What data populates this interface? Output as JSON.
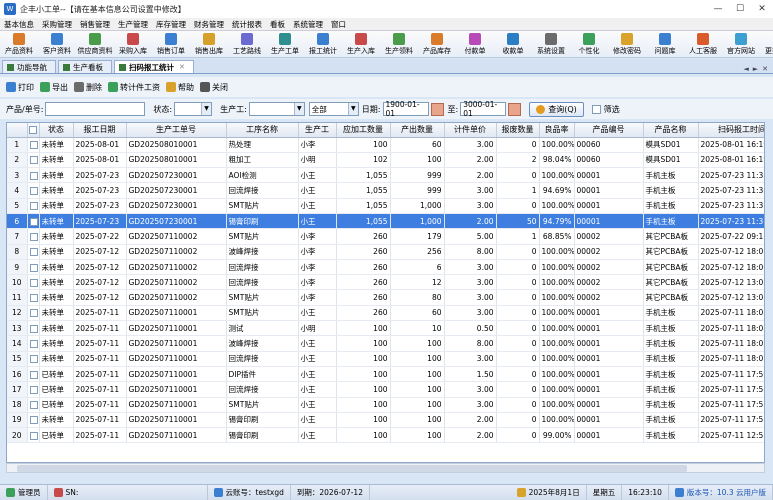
{
  "window": {
    "title": "企丰小工单--【请在基本信息公司设置中修改】",
    "controls": [
      "—",
      "☐",
      "✕"
    ]
  },
  "menu": [
    "基本信息",
    "采购管理",
    "销售管理",
    "生产管理",
    "库存管理",
    "财务管理",
    "统计报表",
    "看板",
    "系统管理",
    "窗口"
  ],
  "toolbar": [
    {
      "label": "产品资料",
      "color": "#d97b2a"
    },
    {
      "label": "客户资料",
      "color": "#3b7fd1"
    },
    {
      "label": "供应商资料",
      "color": "#4a9b4a"
    },
    {
      "label": "采购入库",
      "color": "#c94a4a"
    },
    {
      "label": "销售订单",
      "color": "#3b7fd1"
    },
    {
      "label": "销售出库",
      "color": "#d6a02a"
    },
    {
      "label": "工艺路线",
      "color": "#6a6ad1"
    },
    {
      "label": "生产工单",
      "color": "#2f8f8f"
    },
    {
      "label": "报工统计",
      "color": "#3b7fd1"
    },
    {
      "label": "生产入库",
      "color": "#c94a4a"
    },
    {
      "label": "生产领料",
      "color": "#4a9b4a"
    },
    {
      "label": "产品库存",
      "color": "#d97b2a"
    },
    {
      "label": "付款单",
      "color": "#b84ab8"
    },
    {
      "label": "收款单",
      "color": "#2a7fc4"
    },
    {
      "label": "系统设置",
      "color": "#6b6b6b"
    },
    {
      "label": "个性化",
      "color": "#3aa05a"
    },
    {
      "label": "修改密码",
      "color": "#d9a22a"
    },
    {
      "label": "问题库",
      "color": "#3b7fd1"
    },
    {
      "label": "人工客服",
      "color": "#d95a2a"
    },
    {
      "label": "官方网站",
      "color": "#3b9fd1"
    },
    {
      "label": "更换皮肤",
      "color": "#c44a8a"
    }
  ],
  "tabs": [
    {
      "label": "功能导航",
      "active": false
    },
    {
      "label": "生产看板",
      "active": false
    },
    {
      "label": "扫码报工统计",
      "active": true
    }
  ],
  "tab_nav": [
    "◄",
    "►",
    "✕"
  ],
  "actions": [
    {
      "label": "打印",
      "color": "#3b7fd1"
    },
    {
      "label": "导出",
      "color": "#3aa05a"
    },
    {
      "label": "删除",
      "color": "#6b6b6b"
    },
    {
      "label": "转计件工资",
      "color": "#3aa05a"
    },
    {
      "label": "帮助",
      "color": "#d9a22a"
    },
    {
      "label": "关闭",
      "color": "#555555"
    }
  ],
  "filters": {
    "product_label": "产品/单号:",
    "status_label": "状态:",
    "worker_label": "生产工:",
    "range_value": "全部",
    "date_label": "日期:",
    "date_from": "1900-01-01",
    "to_label": "至:",
    "date_to": "3000-01-01",
    "query_label": "查询(Q)",
    "filter_label": "筛选"
  },
  "table": {
    "headers": [
      "",
      "",
      "状态",
      "报工日期",
      "生产工单号",
      "工序名称",
      "生产工",
      "应加工数量",
      "产出数量",
      "计件单价",
      "报废数量",
      "良品率",
      "产品编号",
      "产品名称",
      "扫码报工时间"
    ],
    "selected_row": 6,
    "rows": [
      [
        "1",
        "未转单",
        "2025-08-01",
        "GD202508010001",
        "热处理",
        "小李",
        "100",
        "60",
        "3.00",
        "0",
        "100.00%",
        "00060",
        "模具SD01",
        "2025-08-01 16:19:05"
      ],
      [
        "2",
        "未转单",
        "2025-08-01",
        "GD202508010001",
        "粗加工",
        "小明",
        "102",
        "100",
        "2.00",
        "2",
        "98.04%",
        "00060",
        "模具SD01",
        "2025-08-01 16:19:03"
      ],
      [
        "3",
        "未转单",
        "2025-07-23",
        "GD202507230001",
        "AOI检测",
        "小王",
        "1,055",
        "999",
        "2.00",
        "0",
        "100.00%",
        "00001",
        "手机主板",
        "2025-07-23 11:35:36"
      ],
      [
        "4",
        "未转单",
        "2025-07-23",
        "GD202507230001",
        "回流焊接",
        "小王",
        "1,055",
        "999",
        "3.00",
        "1",
        "94.69%",
        "00001",
        "手机主板",
        "2025-07-23 11:35:26"
      ],
      [
        "5",
        "未转单",
        "2025-07-23",
        "GD202507230001",
        "SMT贴片",
        "小王",
        "1,055",
        "1,000",
        "3.00",
        "0",
        "100.00%",
        "00001",
        "手机主板",
        "2025-07-23 11:35:13"
      ],
      [
        "6",
        "未转单",
        "2025-07-23",
        "GD202507230001",
        "锡膏印刷",
        "小王",
        "1,055",
        "1,000",
        "2.00",
        "50",
        "94.79%",
        "00001",
        "手机主板",
        "2025-07-23 11:31:48"
      ],
      [
        "7",
        "未转单",
        "2025-07-22",
        "GD202507110002",
        "SMT贴片",
        "小李",
        "260",
        "179",
        "5.00",
        "1",
        "68.85%",
        "00002",
        "其它PCBA板",
        "2025-07-22 09:15:26"
      ],
      [
        "8",
        "未转单",
        "2025-07-12",
        "GD202507110002",
        "波峰焊接",
        "小李",
        "260",
        "256",
        "8.00",
        "0",
        "100.00%",
        "00002",
        "其它PCBA板",
        "2025-07-12 18:07:08"
      ],
      [
        "9",
        "未转单",
        "2025-07-12",
        "GD202507110002",
        "回流焊接",
        "小李",
        "260",
        "6",
        "3.00",
        "0",
        "100.00%",
        "00002",
        "其它PCBA板",
        "2025-07-12 18:06:05"
      ],
      [
        "10",
        "未转单",
        "2025-07-12",
        "GD202507110002",
        "回流焊接",
        "小李",
        "260",
        "12",
        "3.00",
        "0",
        "100.00%",
        "00002",
        "其它PCBA板",
        "2025-07-12 13:03:57"
      ],
      [
        "11",
        "未转单",
        "2025-07-12",
        "GD202507110002",
        "SMT贴片",
        "小李",
        "260",
        "80",
        "3.00",
        "0",
        "100.00%",
        "00002",
        "其它PCBA板",
        "2025-07-12 13:03:33"
      ],
      [
        "12",
        "未转单",
        "2025-07-11",
        "GD202507110001",
        "SMT贴片",
        "小王",
        "260",
        "60",
        "3.00",
        "0",
        "100.00%",
        "00001",
        "手机主板",
        "2025-07-11 18:05:44"
      ],
      [
        "13",
        "未转单",
        "2025-07-11",
        "GD202507110001",
        "测试",
        "小明",
        "100",
        "10",
        "0.50",
        "0",
        "100.00%",
        "00001",
        "手机主板",
        "2025-07-11 18:03:07"
      ],
      [
        "14",
        "未转单",
        "2025-07-11",
        "GD202507110001",
        "波峰焊接",
        "小王",
        "100",
        "100",
        "8.00",
        "0",
        "100.00%",
        "00001",
        "手机主板",
        "2025-07-11 18:02:37"
      ],
      [
        "15",
        "未转单",
        "2025-07-11",
        "GD202507110001",
        "回流焊接",
        "小王",
        "100",
        "100",
        "3.00",
        "0",
        "100.00%",
        "00001",
        "手机主板",
        "2025-07-11 18:01:53"
      ],
      [
        "16",
        "已转单",
        "2025-07-11",
        "GD202507110001",
        "DIP插件",
        "小王",
        "100",
        "100",
        "1.50",
        "0",
        "100.00%",
        "00001",
        "手机主板",
        "2025-07-11 17:59:13"
      ],
      [
        "17",
        "已转单",
        "2025-07-11",
        "GD202507110001",
        "回流焊接",
        "小王",
        "100",
        "100",
        "3.00",
        "0",
        "100.00%",
        "00001",
        "手机主板",
        "2025-07-11 17:56:03"
      ],
      [
        "18",
        "已转单",
        "2025-07-11",
        "GD202507110001",
        "SMT贴片",
        "小王",
        "100",
        "100",
        "3.00",
        "0",
        "100.00%",
        "00001",
        "手机主板",
        "2025-07-11 17:52:13"
      ],
      [
        "19",
        "未转单",
        "2025-07-11",
        "GD202507110001",
        "锡膏印刷",
        "小王",
        "100",
        "100",
        "2.00",
        "0",
        "100.00%",
        "00001",
        "手机主板",
        "2025-07-11 17:52:13"
      ],
      [
        "20",
        "已转单",
        "2025-07-11",
        "GD202507110001",
        "锡膏印刷",
        "小王",
        "100",
        "100",
        "2.00",
        "0",
        "99.00%",
        "00001",
        "手机主板",
        "2025-07-11 12:55:36"
      ]
    ]
  },
  "status": {
    "user": "管理员",
    "sn": "SN:",
    "cloud": "云账号：testxgd",
    "expiry": "到期：2026-07-12",
    "today": "2025年8月1日",
    "weekday": "星期五",
    "time": "16:23:10",
    "version": "版本号：10.3 云用户版"
  }
}
